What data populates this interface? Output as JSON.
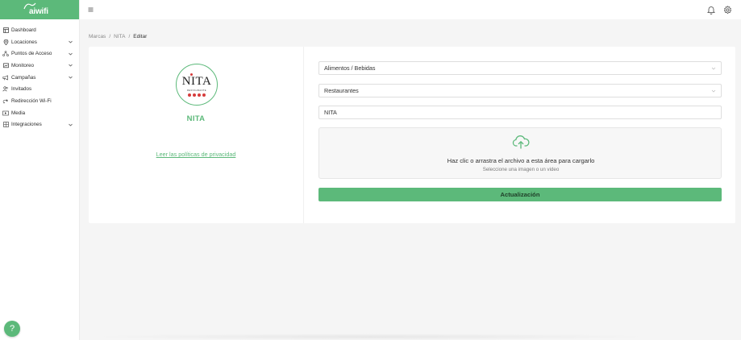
{
  "app": {
    "logo_text": "aiwifi",
    "brand_color": "#5cb97a"
  },
  "sidebar": {
    "items": [
      {
        "label": "Dashboard",
        "icon": "dashboard-icon",
        "expandable": false
      },
      {
        "label": "Locaciones",
        "icon": "location-pin-icon",
        "expandable": true
      },
      {
        "label": "Puntos de Acceso",
        "icon": "access-point-icon",
        "expandable": true
      },
      {
        "label": "Monitoreo",
        "icon": "monitor-icon",
        "expandable": true
      },
      {
        "label": "Campañas",
        "icon": "megaphone-icon",
        "expandable": true
      },
      {
        "label": "Invitados",
        "icon": "users-icon",
        "expandable": false
      },
      {
        "label": "Redirección Wi-Fi",
        "icon": "redirect-icon",
        "expandable": false
      },
      {
        "label": "Media",
        "icon": "media-icon",
        "expandable": false
      },
      {
        "label": "Integraciones",
        "icon": "integrations-icon",
        "expandable": true
      }
    ]
  },
  "topbar": {
    "menu_icon": "menu-icon",
    "bell_icon": "bell-icon",
    "settings_icon": "gear-icon"
  },
  "breadcrumb": {
    "items": [
      "Marcas",
      "NITA"
    ],
    "current": "Editar",
    "separator": "/"
  },
  "brand": {
    "logo_wordmark": "NITA",
    "logo_subtitle": "RESTAURANTE",
    "name": "NITA",
    "privacy_link": "Leer las políticas de privacidad"
  },
  "form": {
    "category": "Alimentos / Bebidas",
    "subcategory": "Restaurantes",
    "name_value": "NITA",
    "upload_title": "Haz clic o arrastra el archivo a esta área para cargarlo",
    "upload_hint": "Seleccione una imagen o un video",
    "submit_label": "Actualización"
  },
  "help": {
    "label": "?"
  }
}
